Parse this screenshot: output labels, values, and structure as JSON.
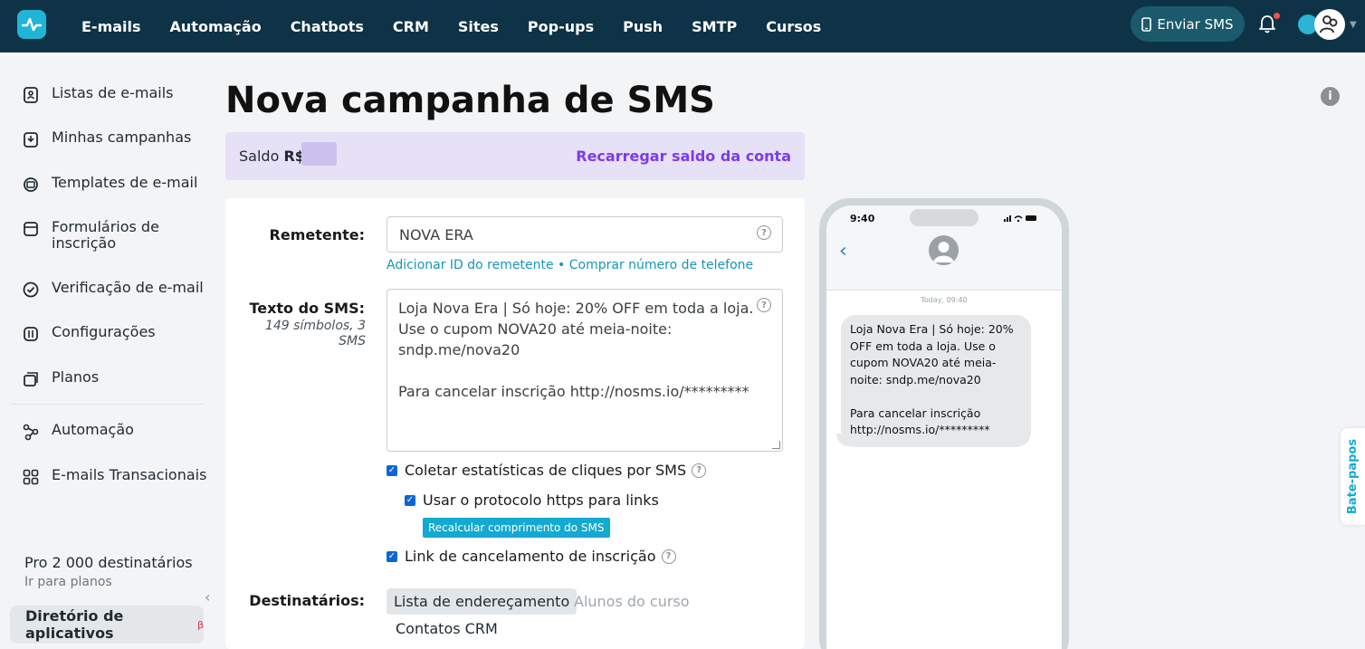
{
  "topnav": {
    "items": [
      "E-mails",
      "Automação",
      "Chatbots",
      "CRM",
      "Sites",
      "Pop-ups",
      "Push",
      "SMTP",
      "Cursos"
    ],
    "sms_button": "Enviar SMS"
  },
  "sidebar": {
    "items": [
      {
        "label": "Listas de e-mails",
        "icon": "list-icon"
      },
      {
        "label": "Minhas campanhas",
        "icon": "campaign-icon"
      },
      {
        "label": "Templates de e-mail",
        "icon": "template-icon"
      },
      {
        "label": "Formulários de inscrição",
        "icon": "form-icon"
      },
      {
        "label": "Verificação de e-mail",
        "icon": "check-icon"
      },
      {
        "label": "Configurações",
        "icon": "settings-icon"
      },
      {
        "label": "Planos",
        "icon": "plans-icon"
      },
      {
        "label": "Automação",
        "icon": "automation-icon"
      },
      {
        "label": "E-mails Transacionais",
        "icon": "grid-icon"
      }
    ],
    "plan_title": "Pro 2 000 destinatários",
    "plan_link": "Ir para planos",
    "app_directory": "Diretório de aplicativos",
    "app_directory_badge": "β"
  },
  "main": {
    "title": "Nova campanha de SMS",
    "balance_label": "Saldo",
    "balance_currency": "R$",
    "balance_link": "Recarregar saldo da conta"
  },
  "form": {
    "sender_label": "Remetente:",
    "sender_value": "NOVA ERA",
    "sender_link_1": "Adicionar ID do remetente",
    "sender_link_sep": " • ",
    "sender_link_2": "Comprar número de telefone",
    "sms_label": "Texto do SMS:",
    "sms_meta": "149 símbolos, 3 SMS",
    "sms_text": "Loja Nova Era | Só hoje: 20% OFF em toda a loja.\nUse o cupom NOVA20 até meia-noite:\nsndp.me/nova20\n\nPara cancelar inscrição http://nosms.io/*********",
    "cb_stats": "Coletar estatísticas de cliques por SMS",
    "cb_https": "Usar o protocolo https para links",
    "recalc_button": "Recalcular comprimento do SMS",
    "cb_unsub": "Link de cancelamento de inscrição",
    "recipients_label": "Destinatários:",
    "tab_lists": "Lista de endereçamento",
    "tab_students": "Alunos do curso",
    "tab_crm": "Contatos CRM"
  },
  "phone": {
    "time": "9:40",
    "today": "Today, 09:40",
    "message": "Loja Nova Era | Só hoje: 20%\nOFF em toda a loja. Use o\ncupom NOVA20 até meia-\nnoite: sndp.me/nova20\n\nPara cancelar inscrição\nhttp://nosms.io/*********"
  },
  "chat_tab": "Bate-papos",
  "colors": {
    "nav_bg": "#0e3347",
    "accent": "#14a9d1",
    "link_purple": "#7c3aed"
  }
}
